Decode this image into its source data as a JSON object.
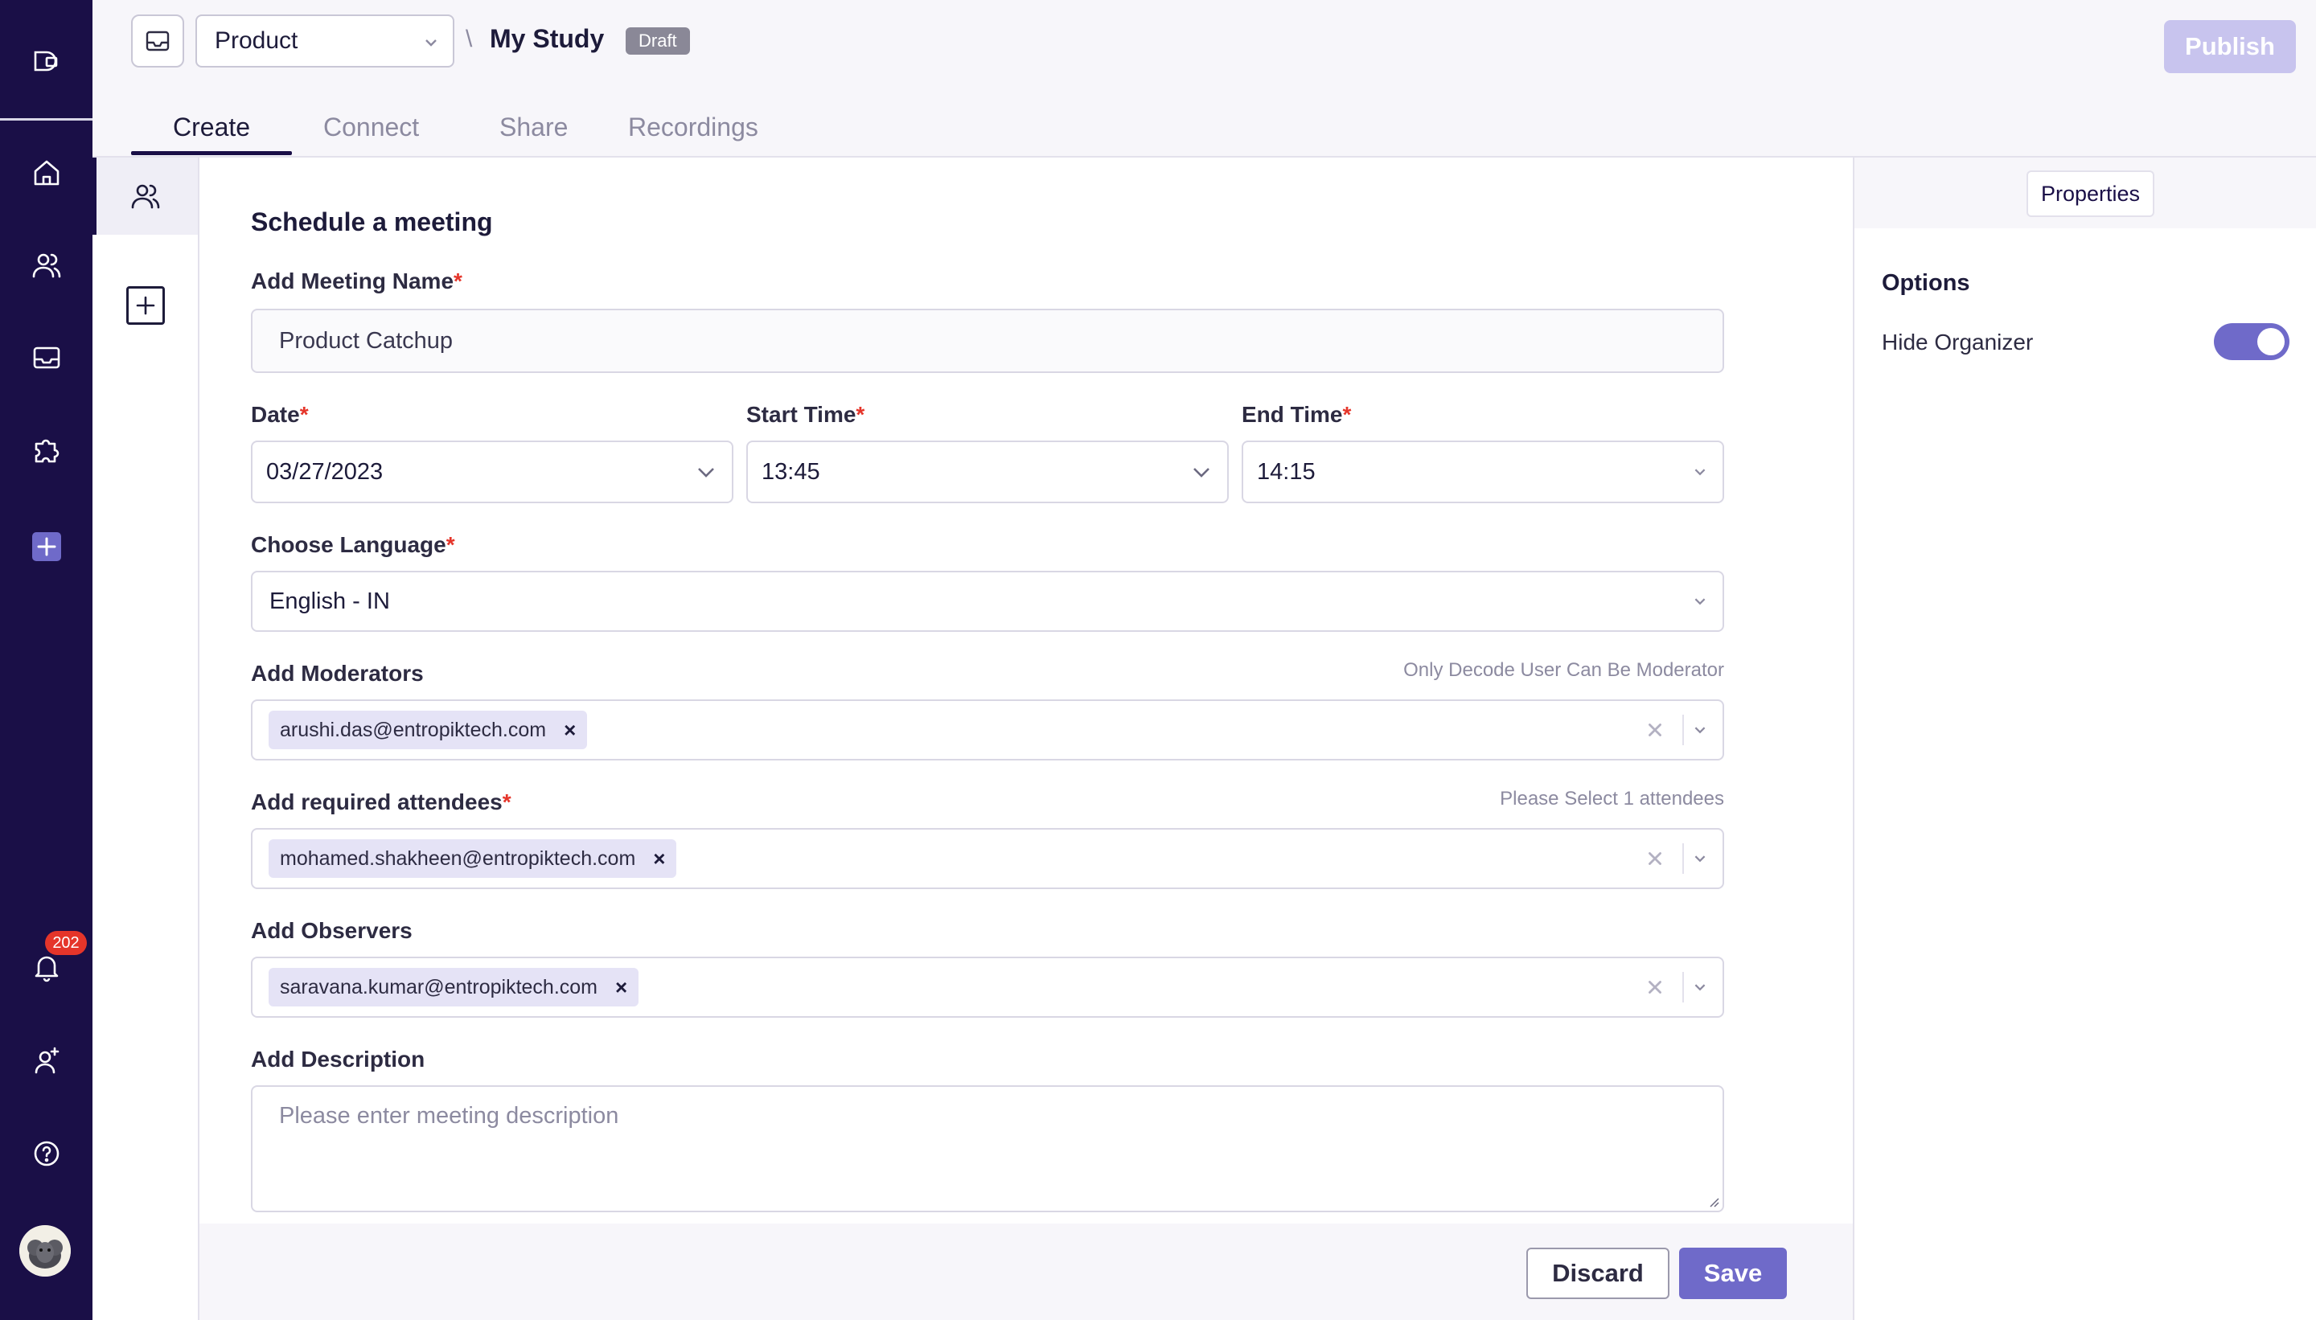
{
  "header": {
    "project_select": "Product",
    "breadcrumb_separator": "\\",
    "study_title": "My Study",
    "status_badge": "Draft",
    "publish_label": "Publish"
  },
  "tabs": [
    {
      "label": "Create",
      "active": true
    },
    {
      "label": "Connect",
      "active": false
    },
    {
      "label": "Share",
      "active": false
    },
    {
      "label": "Recordings",
      "active": false
    }
  ],
  "nav": {
    "notification_count": "202",
    "icons": [
      "logo-icon",
      "home-icon",
      "users-icon",
      "inbox-icon",
      "puzzle-icon",
      "add-icon",
      "bell-icon",
      "add-user-icon",
      "help-icon",
      "avatar"
    ]
  },
  "form": {
    "title": "Schedule a meeting",
    "required_mark": "*",
    "meeting_name": {
      "label": "Add Meeting Name",
      "value": "Product Catchup"
    },
    "date": {
      "label": "Date",
      "value": "03/27/2023"
    },
    "start_time": {
      "label": "Start Time",
      "value": "13:45"
    },
    "end_time": {
      "label": "End Time",
      "value": "14:15"
    },
    "language": {
      "label": "Choose Language",
      "value": "English - IN"
    },
    "moderators": {
      "label": "Add Moderators",
      "hint": "Only Decode User Can Be Moderator",
      "chips": [
        "arushi.das@entropiktech.com"
      ]
    },
    "attendees": {
      "label": "Add required attendees",
      "hint": "Please Select 1 attendees",
      "chips": [
        "mohamed.shakheen@entropiktech.com"
      ]
    },
    "observers": {
      "label": "Add Observers",
      "chips": [
        "saravana.kumar@entropiktech.com"
      ]
    },
    "description": {
      "label": "Add Description",
      "placeholder": "Please enter meeting description"
    },
    "discard_label": "Discard",
    "save_label": "Save"
  },
  "properties": {
    "tab_label": "Properties",
    "options_title": "Options",
    "hide_organizer_label": "Hide Organizer",
    "hide_organizer_on": true
  },
  "colors": {
    "nav_bg": "#1a0f47",
    "accent": "#6f6ac9",
    "publish_disabled": "#c8c4ee",
    "required": "#e5352a"
  }
}
